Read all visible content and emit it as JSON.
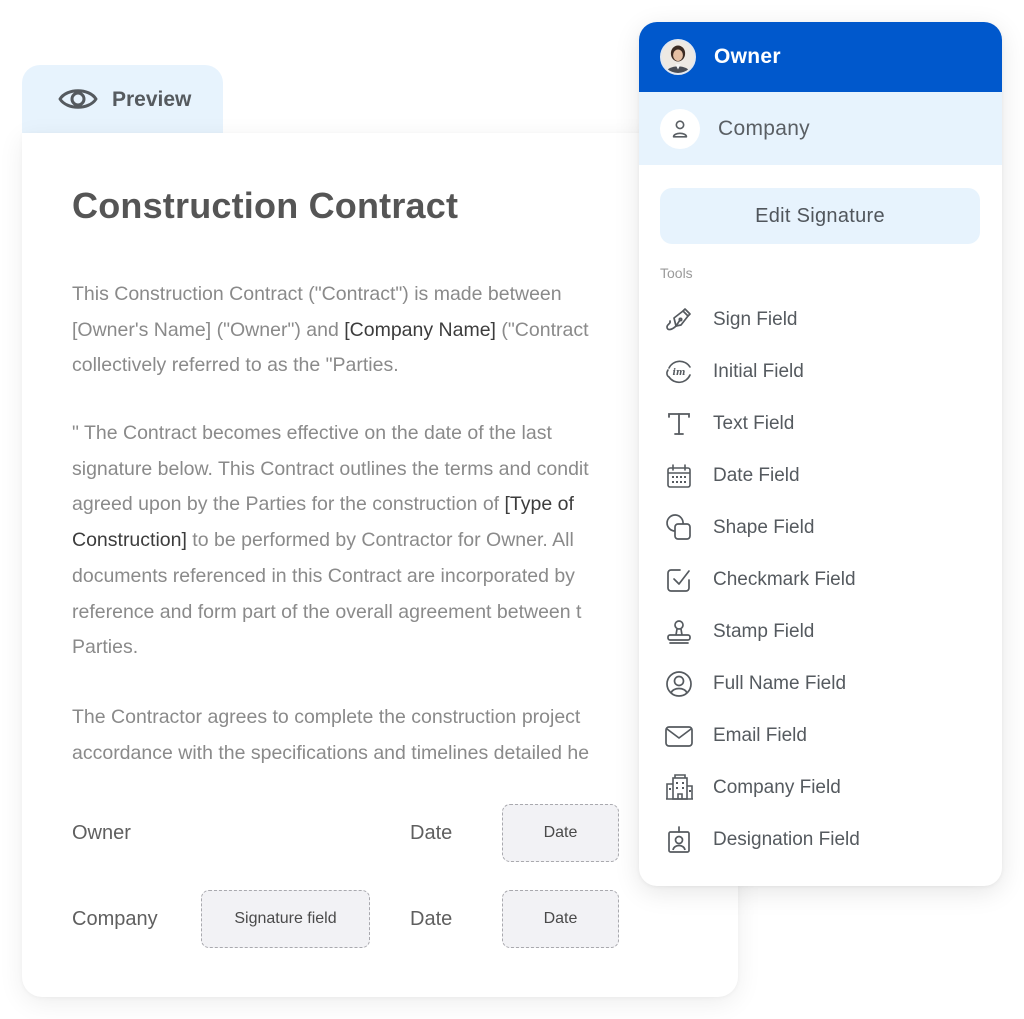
{
  "preview_tab": {
    "label": "Preview",
    "icon": "eye-icon"
  },
  "document": {
    "title": "Construction Contract",
    "paragraphs": [
      {
        "lines": [
          [
            {
              "t": "This Construction Contract (\"Contract\") is made between",
              "hl": false
            }
          ],
          [
            {
              "t": "[Owner's Name] (\"Owner\") and ",
              "hl": false
            },
            {
              "t": "[Company Name]",
              "hl": true
            },
            {
              "t": " (\"Contract",
              "hl": false
            }
          ],
          [
            {
              "t": "collectively referred to as the \"Parties.",
              "hl": false
            }
          ]
        ]
      },
      {
        "lines": [
          [
            {
              "t": "\" The Contract becomes effective on the date of the last",
              "hl": false
            }
          ],
          [
            {
              "t": "signature below. This Contract outlines the terms and condit",
              "hl": false
            }
          ],
          [
            {
              "t": "agreed upon by the Parties for the construction of ",
              "hl": false
            },
            {
              "t": "[Type of",
              "hl": true
            }
          ],
          [
            {
              "t": "Construction]",
              "hl": true
            },
            {
              "t": " to be performed by Contractor for Owner. All",
              "hl": false
            }
          ],
          [
            {
              "t": "documents referenced in this Contract are incorporated by",
              "hl": false
            }
          ],
          [
            {
              "t": "reference and form part of the overall agreement between t",
              "hl": false
            }
          ],
          [
            {
              "t": "Parties.",
              "hl": false
            }
          ]
        ]
      },
      {
        "lines": [
          [
            {
              "t": "The Contractor agrees to complete the construction project",
              "hl": false
            }
          ],
          [
            {
              "t": "accordance with the specifications and timelines detailed he",
              "hl": false
            }
          ]
        ]
      }
    ],
    "signature_rows": [
      {
        "party": "Owner",
        "signature_field": null,
        "date_label": "Date",
        "date_field": "Date"
      },
      {
        "party": "Company",
        "signature_field": "Signature field",
        "date_label": "Date",
        "date_field": "Date"
      }
    ]
  },
  "panel": {
    "roles": [
      {
        "name": "Owner",
        "active": true,
        "icon": "avatar-photo"
      },
      {
        "name": "Company",
        "active": false,
        "icon": "person-icon"
      }
    ],
    "edit_signature_label": "Edit Signature",
    "tools_heading": "Tools",
    "tools": [
      {
        "label": "Sign Field",
        "icon": "pen-nib-icon"
      },
      {
        "label": "Initial Field",
        "icon": "initials-icon"
      },
      {
        "label": "Text Field",
        "icon": "text-icon"
      },
      {
        "label": "Date Field",
        "icon": "calendar-icon"
      },
      {
        "label": "Shape Field",
        "icon": "shapes-icon"
      },
      {
        "label": "Checkmark Field",
        "icon": "checkbox-icon"
      },
      {
        "label": "Stamp Field",
        "icon": "stamp-icon"
      },
      {
        "label": "Full Name Field",
        "icon": "user-circle-icon"
      },
      {
        "label": "Email Field",
        "icon": "envelope-icon"
      },
      {
        "label": "Company Field",
        "icon": "building-icon"
      },
      {
        "label": "Designation Field",
        "icon": "id-badge-icon"
      }
    ]
  },
  "colors": {
    "brand_blue": "#0058cc",
    "light_blue": "#e7f3fd",
    "field_fill": "#f2f2f5"
  }
}
